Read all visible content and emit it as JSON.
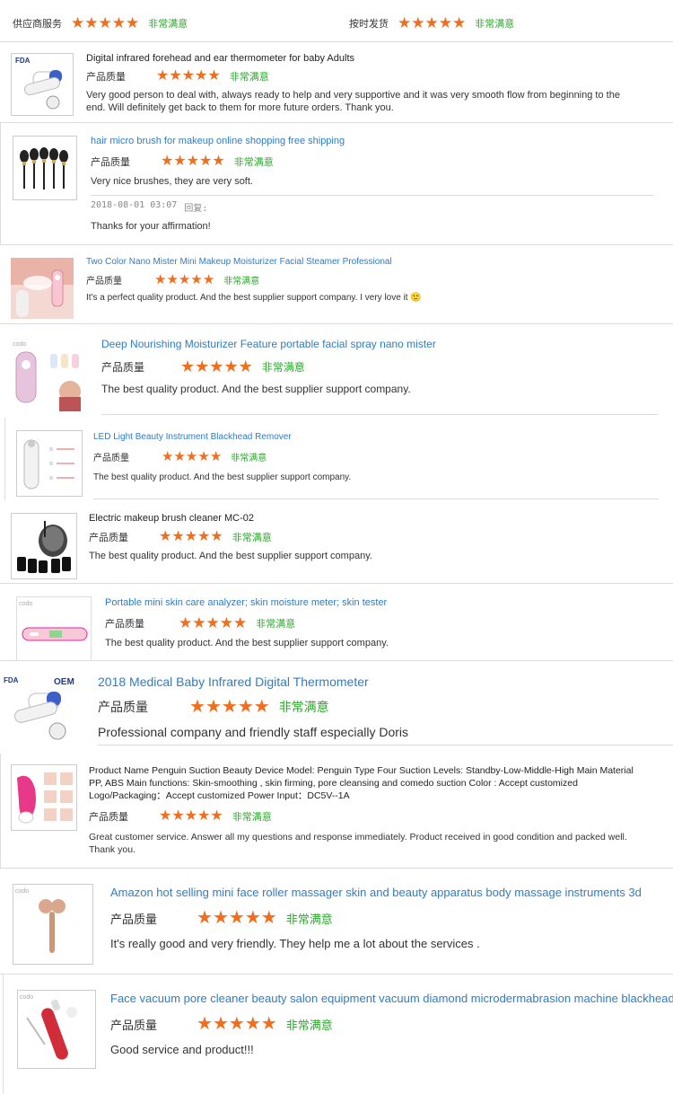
{
  "summary": {
    "supplier_label": "供应商服务",
    "supplier_rating": "非常满意",
    "delivery_label": "按时发货",
    "delivery_rating": "非常满意"
  },
  "colors": {
    "star": "#f06e1e",
    "satisfied": "#2ba82b",
    "link": "#2f7dc1"
  },
  "quality_label": "产品质量",
  "star_glyph": "★",
  "reviews": [
    {
      "title": "Digital infrared forehead and ear thermometer for baby Adults",
      "rating": "非常满意",
      "stars": 5,
      "text": "Very good person to deal with, always ready to help and very supportive and it was very smooth flow from beginning to the end. Will definitely get back to them for more future orders. Thank you.",
      "thumb_logo": "FDA"
    },
    {
      "title": "hair micro brush for makeup online shopping free shipping",
      "rating": "非常满意",
      "stars": 5,
      "text": "Very nice brushes, they are very soft.",
      "reply_date": "2018-08-01 03:07",
      "reply_label": "回复:",
      "reply_text": "Thanks for your affirmation!"
    },
    {
      "title": "Two Color Nano Mister Mini Makeup Moisturizer Facial Steamer Professional",
      "rating": "非常满意",
      "stars": 5,
      "text": "It's a perfect quality product. And the best supplier support company. I very love it 🙂"
    },
    {
      "title": "Deep Nourishing Moisturizer Feature portable facial spray nano mister",
      "rating": "非常满意",
      "stars": 5,
      "text": "The best quality product. And the best supplier support company.",
      "thumb_logo": "codo"
    },
    {
      "title": "LED Light Beauty Instrument Blackhead Remover",
      "rating": "非常满意",
      "stars": 5,
      "text": "The best quality product. And the best supplier support company."
    },
    {
      "title": "Electric makeup brush cleaner MC-02",
      "rating": "非常满意",
      "stars": 5,
      "text": "The best quality product. And the best supplier support company."
    },
    {
      "title": "Portable mini skin care analyzer; skin moisture meter; skin tester",
      "rating": "非常满意",
      "stars": 5,
      "text": "The best quality product. And the best supplier support company.",
      "thumb_logo": "codo"
    },
    {
      "title": "2018 Medical Baby Infrared Digital Thermometer",
      "rating": "非常满意",
      "stars": 5,
      "text": "Professional company and friendly staff especially Doris",
      "thumb_logo": "FDA",
      "thumb_logo2": "OEM"
    },
    {
      "title": "Product Name Penguin Suction Beauty Device Model: Penguin Type Four Suction Levels: Standby-Low-Middle-High Main Material PP, ABS Main functions: Skin-smoothing , skin firming, pore cleansing and comedo suction Color : Accept customized Logo/Packaging：Accept customized Power Input：DC5V--1A",
      "rating": "非常满意",
      "stars": 5,
      "text": "Great customer service. Answer all my questions and response immediately. Product received in good condition and packed well. Thank you."
    },
    {
      "title": "Amazon hot selling mini face roller massager skin and beauty apparatus body massage instruments 3d",
      "rating": "非常满意",
      "stars": 5,
      "text": "It's really good and very friendly. They help me a lot about the services .",
      "thumb_logo": "codo"
    },
    {
      "title": "Face vacuum pore cleaner beauty salon equipment vacuum diamond microdermabrasion machine blackhead",
      "rating": "非常满意",
      "stars": 5,
      "text": "Good service and product!!!",
      "thumb_logo": "codo"
    }
  ]
}
